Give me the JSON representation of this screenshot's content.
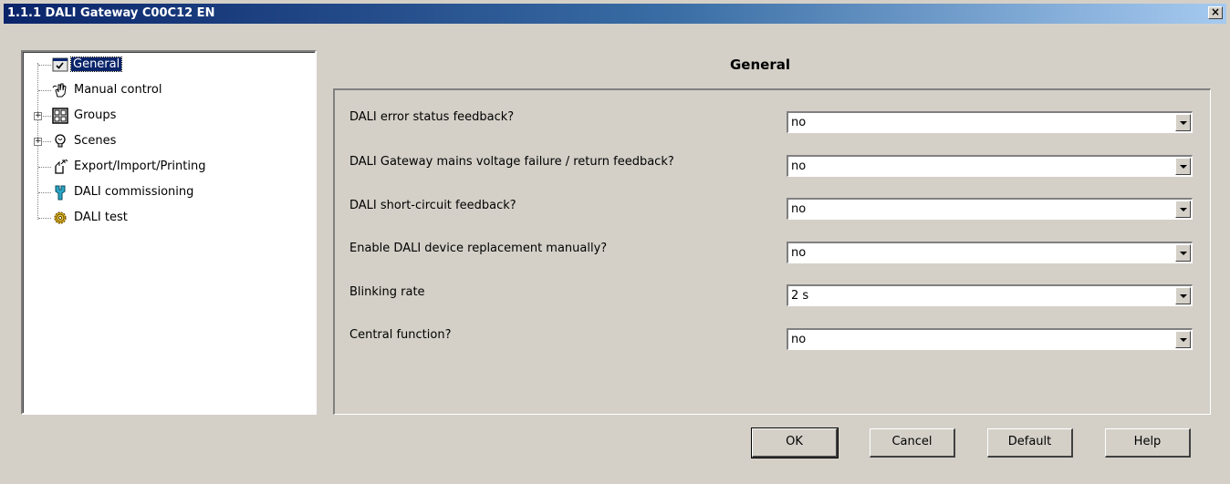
{
  "window": {
    "title": "1.1.1 DALI Gateway C00C12 EN",
    "close_label": "×"
  },
  "tree": {
    "items": [
      {
        "label": "General",
        "icon": "checklist-icon",
        "selected": true,
        "expandable": false
      },
      {
        "label": "Manual control",
        "icon": "hand-icon",
        "selected": false,
        "expandable": false
      },
      {
        "label": "Groups",
        "icon": "grid-icon",
        "selected": false,
        "expandable": true,
        "expander": "+"
      },
      {
        "label": "Scenes",
        "icon": "bulb-icon",
        "selected": false,
        "expandable": true,
        "expander": "+"
      },
      {
        "label": "Export/Import/Printing",
        "icon": "export-icon",
        "selected": false,
        "expandable": false
      },
      {
        "label": "DALI commissioning",
        "icon": "wrench-icon",
        "selected": false,
        "expandable": false
      },
      {
        "label": "DALI test",
        "icon": "gear-icon",
        "selected": false,
        "expandable": false
      }
    ]
  },
  "page": {
    "title": "General",
    "params": [
      {
        "label": "DALI error status feedback?",
        "value": "no"
      },
      {
        "label": "DALI Gateway mains voltage failure / return feedback?",
        "value": "no"
      },
      {
        "label": "DALI short-circuit feedback?",
        "value": "no"
      },
      {
        "label": "Enable DALI device replacement manually?",
        "value": "no"
      },
      {
        "label": "Blinking rate",
        "value": "2 s"
      },
      {
        "label": "Central function?",
        "value": "no"
      }
    ]
  },
  "buttons": {
    "ok": "OK",
    "cancel": "Cancel",
    "default": "Default",
    "help": "Help"
  },
  "colors": {
    "titlebar_start": "#0a246a",
    "titlebar_end": "#a6caf0",
    "face": "#d4d0c8",
    "selection": "#0a246a"
  }
}
